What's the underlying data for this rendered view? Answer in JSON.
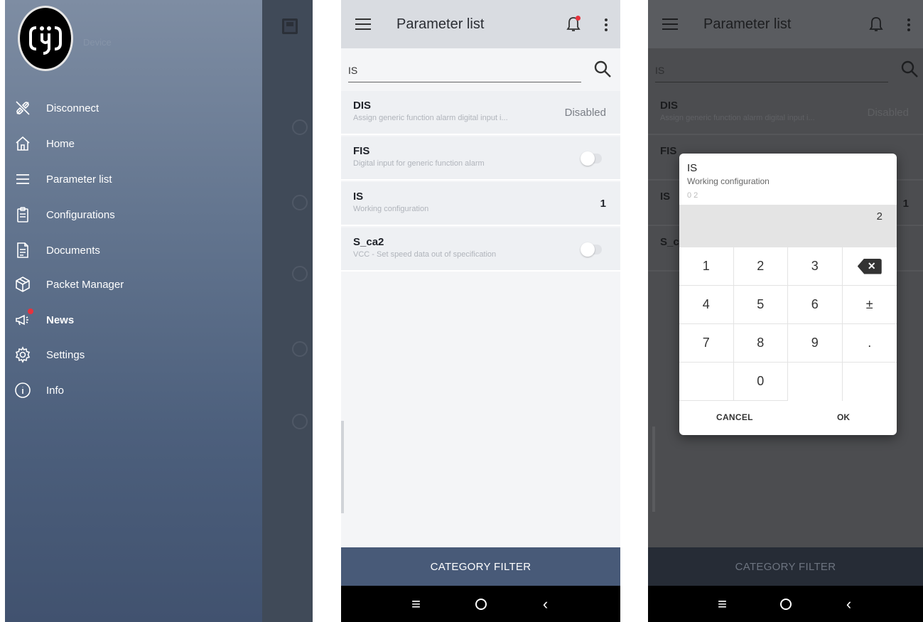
{
  "drawer": {
    "device_name": "Device",
    "items": [
      {
        "label": "Disconnect"
      },
      {
        "label": "Home"
      },
      {
        "label": "Parameter list"
      },
      {
        "label": "Configurations"
      },
      {
        "label": "Documents"
      },
      {
        "label": "Packet Manager"
      },
      {
        "label": "News"
      },
      {
        "label": "Settings"
      },
      {
        "label": "Info"
      }
    ]
  },
  "parameter_screen": {
    "title": "Parameter list",
    "search_value": "IS",
    "rows": [
      {
        "name": "DIS",
        "desc": "Assign generic function alarm digital input i...",
        "value": "Disabled"
      },
      {
        "name": "FIS",
        "desc": "Digital input for generic function alarm"
      },
      {
        "name": "IS",
        "desc": "Working configuration",
        "value": "1"
      },
      {
        "name": "S_ca2",
        "desc": "VCC - Set speed data out of specification"
      }
    ],
    "category_filter": "CATEGORY FILTER"
  },
  "dialog": {
    "name": "IS",
    "desc": "Working configuration",
    "range": "0 2",
    "input_value": "2",
    "keys": [
      "1",
      "2",
      "3",
      "⌫",
      "4",
      "5",
      "6",
      "±",
      "7",
      "8",
      "9",
      ".",
      "",
      "0",
      "",
      ""
    ],
    "cancel": "CANCEL",
    "ok": "OK"
  },
  "colors": {
    "accent": "#485a78",
    "badge": "#e8323c"
  }
}
